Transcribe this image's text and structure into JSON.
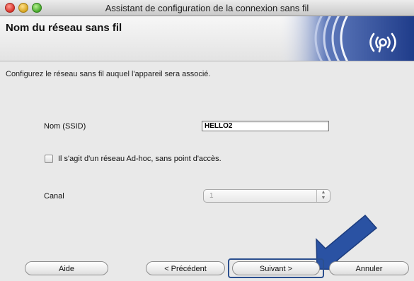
{
  "window": {
    "title": "Assistant de configuration de la connexion sans fil"
  },
  "header": {
    "title": "Nom du réseau sans fil",
    "banner_icon": "wireless-signal-icon"
  },
  "content": {
    "instruction": "Configurez le réseau sans fil auquel l'appareil sera associé.",
    "ssid_label": "Nom (SSID)",
    "ssid_value": "HELLO2",
    "adhoc_label": "Il s'agit d'un réseau Ad-hoc, sans point d'accès.",
    "adhoc_checked": false,
    "channel_label": "Canal",
    "channel_value": "1"
  },
  "buttons": {
    "help": "Aide",
    "previous": "< Précédent",
    "next": "Suivant >",
    "cancel": "Annuler"
  },
  "colors": {
    "banner": "#2f4f9c",
    "arrow": "#2a52a3",
    "focus": "#2b4f8f"
  }
}
